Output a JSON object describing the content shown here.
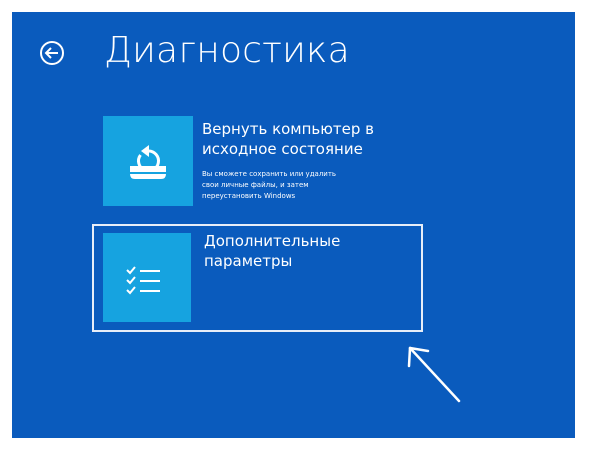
{
  "header": {
    "title": "Диагностика",
    "back_icon": "back-arrow-circle-icon"
  },
  "options": [
    {
      "title_lines": [
        "Вернуть компьютер в",
        "исходное состояние"
      ],
      "description_lines": [
        "Вы сможете сохранить или удалить",
        "свои личные файлы, и затем",
        "переустановить Windows"
      ],
      "icon": "reset-pc-icon"
    },
    {
      "title_lines": [
        "Дополнительные",
        "параметры"
      ],
      "icon": "checklist-icon",
      "highlighted": true
    }
  ],
  "annotation": {
    "icon": "pointer-arrow-icon"
  },
  "colors": {
    "background": "#0a5bbd",
    "tile": "#16a3e0",
    "text": "#ffffff",
    "highlight_border": "#e8eef8"
  }
}
